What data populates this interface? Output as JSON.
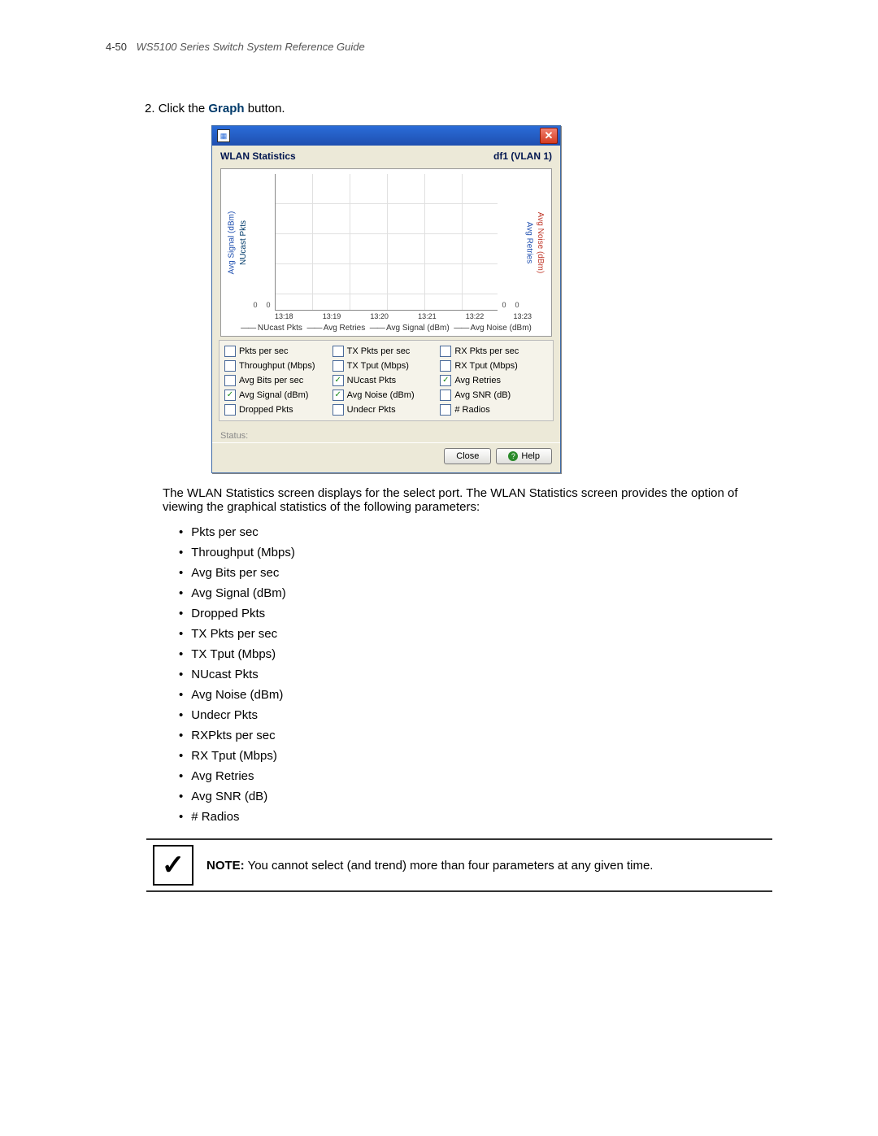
{
  "header": {
    "page_number": "4-50",
    "doc_title": "WS5100 Series Switch System Reference Guide"
  },
  "step": {
    "number": "2.",
    "prefix": "Click the ",
    "bold": "Graph",
    "suffix": " button."
  },
  "dialog": {
    "title_left": "WLAN Statistics",
    "title_right": "df1 (VLAN 1)",
    "ylabels": {
      "avg_signal": "Avg Signal (dBm)",
      "nucast": "NUcast Pkts",
      "avg_retries": "Avg Retries",
      "avg_noise": "Avg Noise (dBm)"
    },
    "zero_left_outer": "0",
    "zero_left_inner": "0",
    "zero_right_inner": "0",
    "zero_right_outer": "0",
    "xticks": [
      "13:18",
      "13:19",
      "13:20",
      "13:21",
      "13:22",
      "13:23"
    ],
    "legend": {
      "a": "NUcast Pkts",
      "b": "Avg Retries",
      "c": "Avg Signal (dBm)",
      "d": "Avg Noise (dBm)"
    },
    "checks": [
      [
        {
          "label": "Pkts per sec",
          "checked": false,
          "name": "pkts-per-sec-checkbox"
        },
        {
          "label": "TX Pkts per sec",
          "checked": false,
          "name": "tx-pkts-per-sec-checkbox"
        },
        {
          "label": "RX Pkts per sec",
          "checked": false,
          "name": "rx-pkts-per-sec-checkbox"
        }
      ],
      [
        {
          "label": "Throughput (Mbps)",
          "checked": false,
          "name": "throughput-checkbox"
        },
        {
          "label": "TX Tput (Mbps)",
          "checked": false,
          "name": "tx-tput-checkbox"
        },
        {
          "label": "RX Tput (Mbps)",
          "checked": false,
          "name": "rx-tput-checkbox"
        }
      ],
      [
        {
          "label": "Avg Bits per sec",
          "checked": false,
          "name": "avg-bits-checkbox"
        },
        {
          "label": "NUcast Pkts",
          "checked": true,
          "name": "nucast-pkts-checkbox"
        },
        {
          "label": "Avg Retries",
          "checked": true,
          "name": "avg-retries-checkbox"
        }
      ],
      [
        {
          "label": "Avg Signal (dBm)",
          "checked": true,
          "name": "avg-signal-checkbox"
        },
        {
          "label": "Avg Noise (dBm)",
          "checked": true,
          "name": "avg-noise-checkbox"
        },
        {
          "label": "Avg SNR (dB)",
          "checked": false,
          "name": "avg-snr-checkbox"
        }
      ],
      [
        {
          "label": "Dropped Pkts",
          "checked": false,
          "name": "dropped-pkts-checkbox"
        },
        {
          "label": "Undecr Pkts",
          "checked": false,
          "name": "undecr-pkts-checkbox"
        },
        {
          "label": "# Radios",
          "checked": false,
          "name": "radios-checkbox"
        }
      ]
    ],
    "status_label": "Status:",
    "close_btn": "Close",
    "help_btn": "Help"
  },
  "body_para": "The WLAN Statistics screen displays for the select port. The WLAN Statistics screen provides the option of viewing the graphical statistics of the following parameters:",
  "param_list": [
    "Pkts per sec",
    "Throughput (Mbps)",
    "Avg Bits per sec",
    "Avg Signal (dBm)",
    "Dropped Pkts",
    "TX Pkts per sec",
    "TX Tput (Mbps)",
    "NUcast Pkts",
    "Avg Noise (dBm)",
    "Undecr Pkts",
    "RXPkts per sec",
    "RX Tput (Mbps)",
    "Avg Retries",
    "Avg SNR (dB)",
    "# Radios"
  ],
  "note": {
    "label": "NOTE:",
    "text": " You cannot select (and trend) more than four parameters at any given time."
  },
  "chart_data": {
    "type": "line",
    "title": "WLAN Statistics",
    "xlabel": "",
    "ylabel": "",
    "x": [
      "13:18",
      "13:19",
      "13:20",
      "13:21",
      "13:22",
      "13:23"
    ],
    "series": [
      {
        "name": "NUcast Pkts",
        "values": [
          0,
          0,
          0,
          0,
          0,
          0
        ]
      },
      {
        "name": "Avg Retries",
        "values": [
          0,
          0,
          0,
          0,
          0,
          0
        ]
      },
      {
        "name": "Avg Signal (dBm)",
        "values": [
          0,
          0,
          0,
          0,
          0,
          0
        ]
      },
      {
        "name": "Avg Noise (dBm)",
        "values": [
          0,
          0,
          0,
          0,
          0,
          0
        ]
      }
    ],
    "ylim": [
      0,
      0
    ]
  }
}
